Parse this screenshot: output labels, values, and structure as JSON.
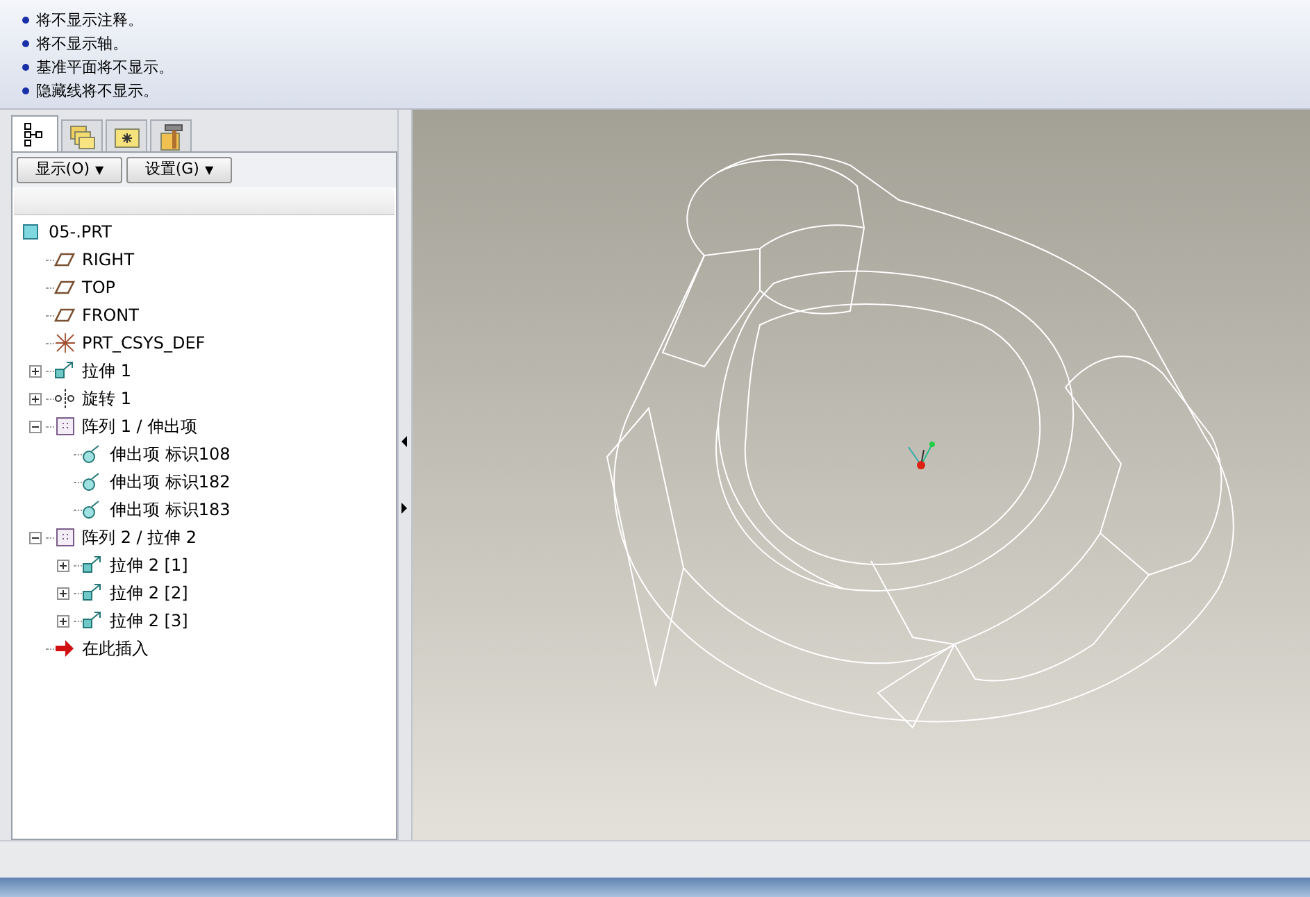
{
  "messages": [
    "将不显示注释。",
    "将不显示轴。",
    "基准平面将不显示。",
    "隐藏线将不显示。"
  ],
  "tabs": [
    {
      "kind": "tree",
      "selected": true
    },
    {
      "kind": "layers",
      "selected": false
    },
    {
      "kind": "favorites",
      "selected": false
    },
    {
      "kind": "tools",
      "selected": false
    }
  ],
  "toolbar": [
    {
      "label": "显示(O)",
      "caret": "▼"
    },
    {
      "label": "设置(G)",
      "caret": "▼"
    }
  ],
  "model_tree": [
    {
      "label": "05-.PRT",
      "kind": "part",
      "children": [
        {
          "label": "RIGHT",
          "kind": "plane"
        },
        {
          "label": "TOP",
          "kind": "plane"
        },
        {
          "label": "FRONT",
          "kind": "plane"
        },
        {
          "label": "PRT_CSYS_DEF",
          "kind": "csys"
        },
        {
          "label": "拉伸 1",
          "kind": "extrude",
          "expanded": false
        },
        {
          "label": "旋转 1",
          "kind": "revolve",
          "expanded": false
        },
        {
          "label": "阵列 1 / 伸出项",
          "kind": "pattern",
          "expanded": true,
          "children": [
            {
              "label": "伸出项 标识108",
              "kind": "protrusion"
            },
            {
              "label": "伸出项 标识182",
              "kind": "protrusion"
            },
            {
              "label": "伸出项 标识183",
              "kind": "protrusion"
            }
          ]
        },
        {
          "label": "阵列 2 / 拉伸 2",
          "kind": "pattern",
          "expanded": true,
          "children": [
            {
              "label": "拉伸 2 [1]",
              "kind": "extrude",
              "expanded": false
            },
            {
              "label": "拉伸 2 [2]",
              "kind": "extrude",
              "expanded": false
            },
            {
              "label": "拉伸 2 [3]",
              "kind": "extrude",
              "expanded": false
            }
          ]
        },
        {
          "label": "在此插入",
          "kind": "insert"
        }
      ]
    }
  ]
}
